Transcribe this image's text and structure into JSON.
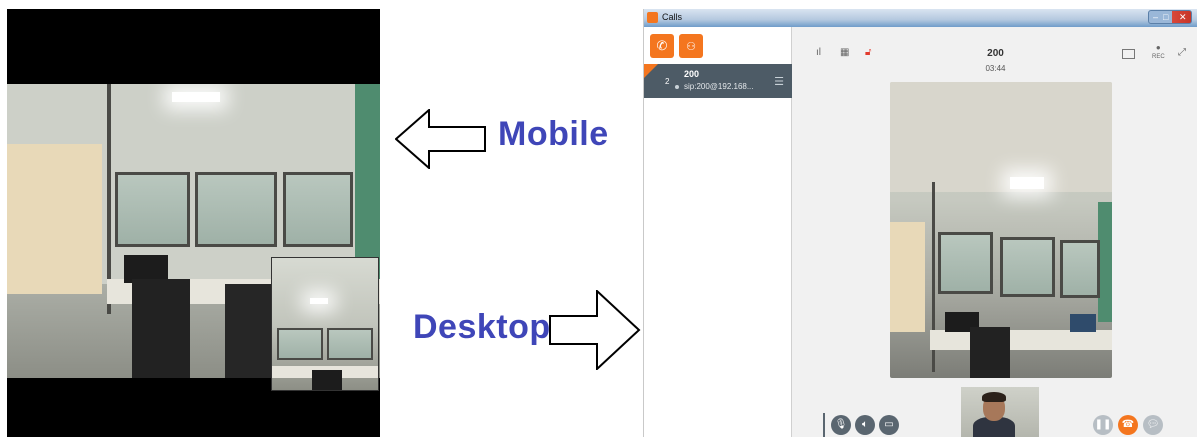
{
  "labels": {
    "mobile": "Mobile",
    "desktop": "Desktop"
  },
  "app": {
    "title": "Calls",
    "window_buttons": {
      "minimize": "–",
      "maximize": "□",
      "close": "✕"
    }
  },
  "sidebar": {
    "new_call_icon": "phone-plus-icon",
    "conference_icon": "group-call-icon",
    "calls": [
      {
        "count": "2",
        "name": "200",
        "address": "sip:200@192.168...",
        "status": "active"
      }
    ]
  },
  "call": {
    "name": "200",
    "duration": "03:44",
    "header_icons": [
      "signal-icon",
      "dialpad-icon",
      "lock-icon",
      "screen-share-icon",
      "record-icon",
      "expand-icon"
    ],
    "rec_label": "REC"
  },
  "controls": {
    "left": [
      "microphone-icon",
      "speaker-icon",
      "video-icon"
    ],
    "right": [
      "hold-icon",
      "transfer-icon",
      "chat-icon"
    ]
  },
  "colors": {
    "accent": "#f4761f",
    "label_blue": "#3f46b8",
    "call_row": "#4d5b66",
    "lock_red": "#e23b2e"
  }
}
